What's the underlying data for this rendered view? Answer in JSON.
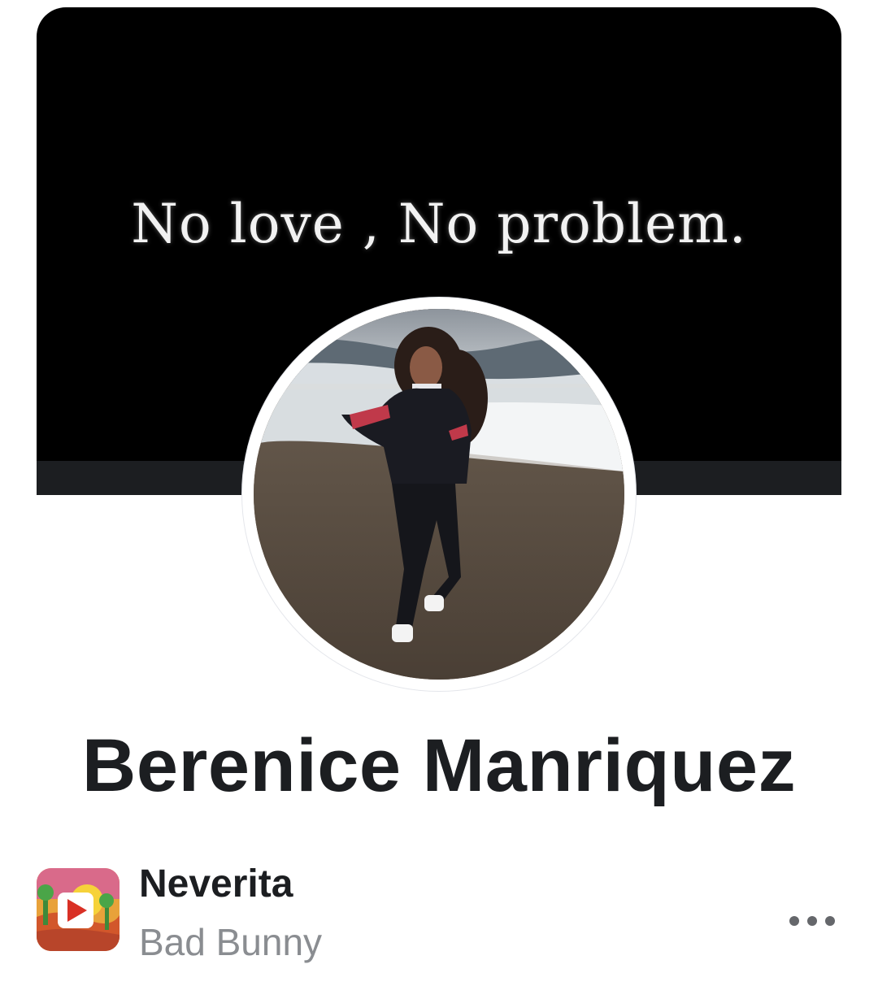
{
  "profile": {
    "cover_text": "No love , No problem.",
    "name": "Berenice Manriquez"
  },
  "song": {
    "title": "Neverita",
    "artist": "Bad Bunny",
    "art_icon": "play-icon"
  },
  "actions": {
    "more_icon": "more-options-icon"
  },
  "colors": {
    "text_primary": "#1c1e21",
    "text_secondary": "#8a8d91",
    "cover_bg": "#000000",
    "icon_gray": "#65676b"
  }
}
